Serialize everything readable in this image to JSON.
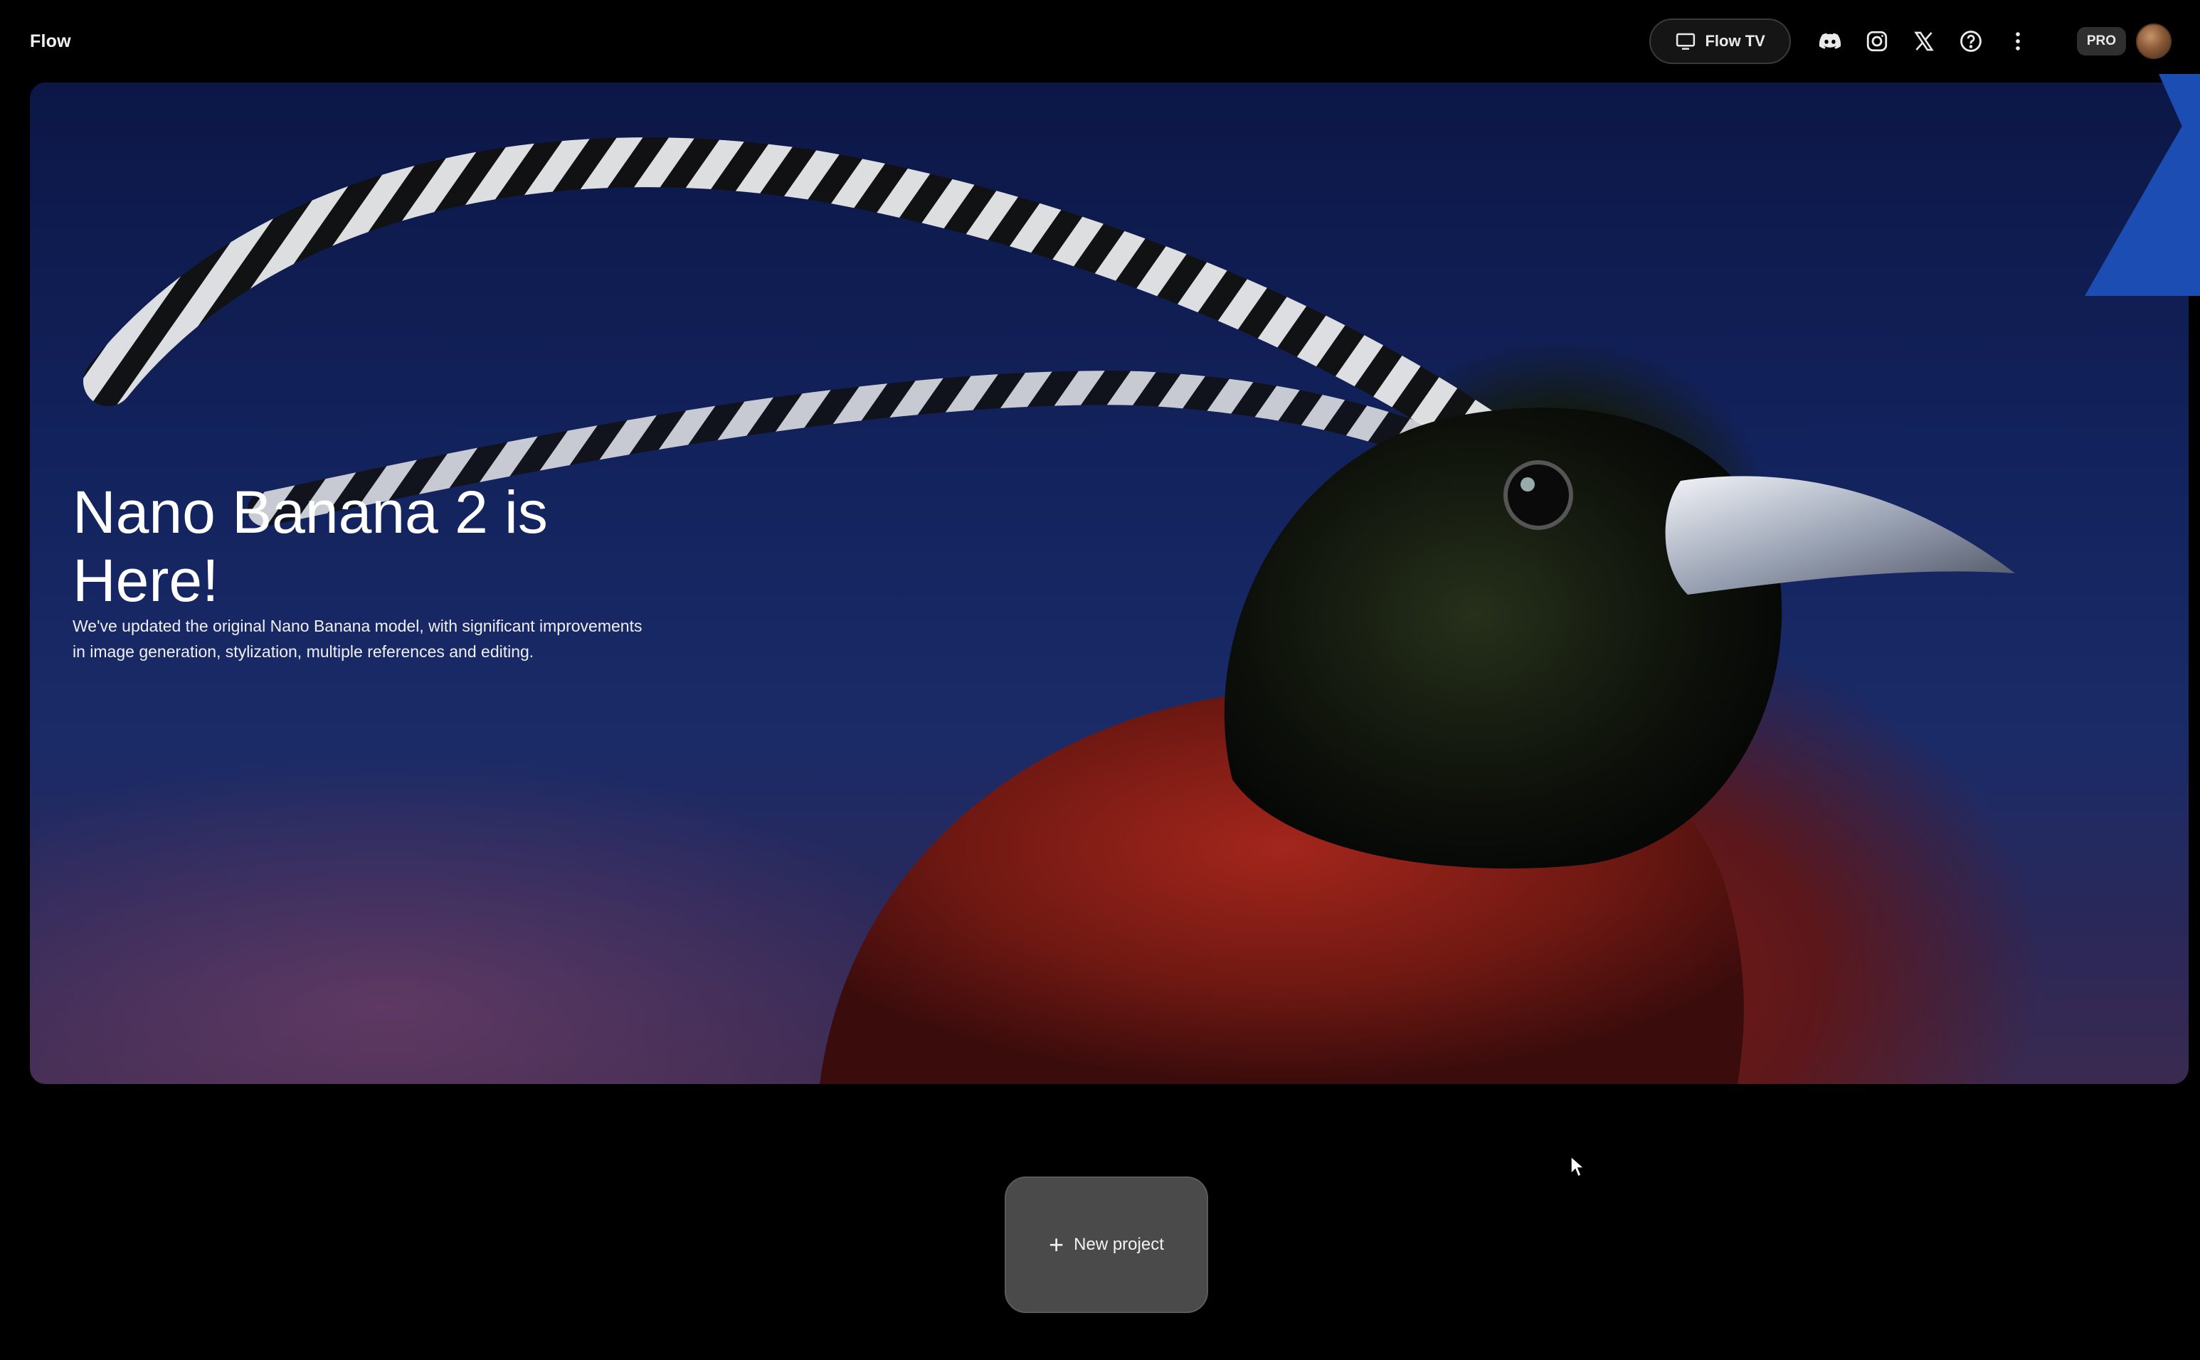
{
  "header": {
    "brand": "Flow",
    "flow_tv_label": "Flow TV",
    "plan_badge": "PRO",
    "icons": [
      "tv-icon",
      "discord-icon",
      "instagram-icon",
      "x-icon",
      "help-icon",
      "more-vert-icon"
    ]
  },
  "hero": {
    "title": "Nano Banana 2 is Here!",
    "description": "We've updated the original Nano Banana model, with significant improvements in image generation, stylization, multiple references and editing."
  },
  "actions": {
    "new_project_label": "New project"
  },
  "colors": {
    "background": "#000000",
    "hero_sky": "#13235e",
    "bird_red": "#7a1a14",
    "button_bg": "#4a4a4a",
    "accent_blue": "#1b4db3"
  }
}
